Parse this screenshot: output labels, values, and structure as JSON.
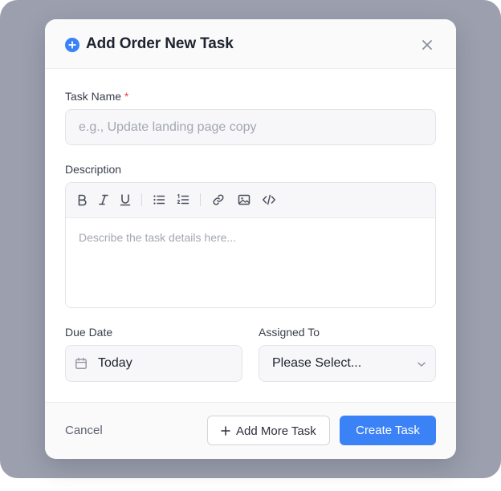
{
  "dialog": {
    "title": "Add Order New Task",
    "header_icon": "plus-circle-icon",
    "close_icon": "close-icon"
  },
  "task_name": {
    "label": "Task Name",
    "required_marker": "*",
    "value": "",
    "placeholder": "e.g., Update landing page copy"
  },
  "description": {
    "label": "Description",
    "value": "",
    "placeholder": "Describe the task details here...",
    "toolbar": [
      "bold-icon",
      "italic-icon",
      "underline-icon",
      "bulleted-list-icon",
      "numbered-list-icon",
      "link-icon",
      "image-icon",
      "code-icon"
    ]
  },
  "due_date": {
    "label": "Due Date",
    "value": "Today",
    "icon": "calendar-icon"
  },
  "assigned_to": {
    "label": "Assigned To",
    "value": "Please Select...",
    "icon": "chevron-down-icon"
  },
  "footer": {
    "cancel_label": "Cancel",
    "add_more_label": "Add More Task",
    "create_label": "Create Task"
  },
  "colors": {
    "accent": "#3b82f6",
    "backdrop": "#9ca0ae",
    "required": "#e5484d"
  }
}
